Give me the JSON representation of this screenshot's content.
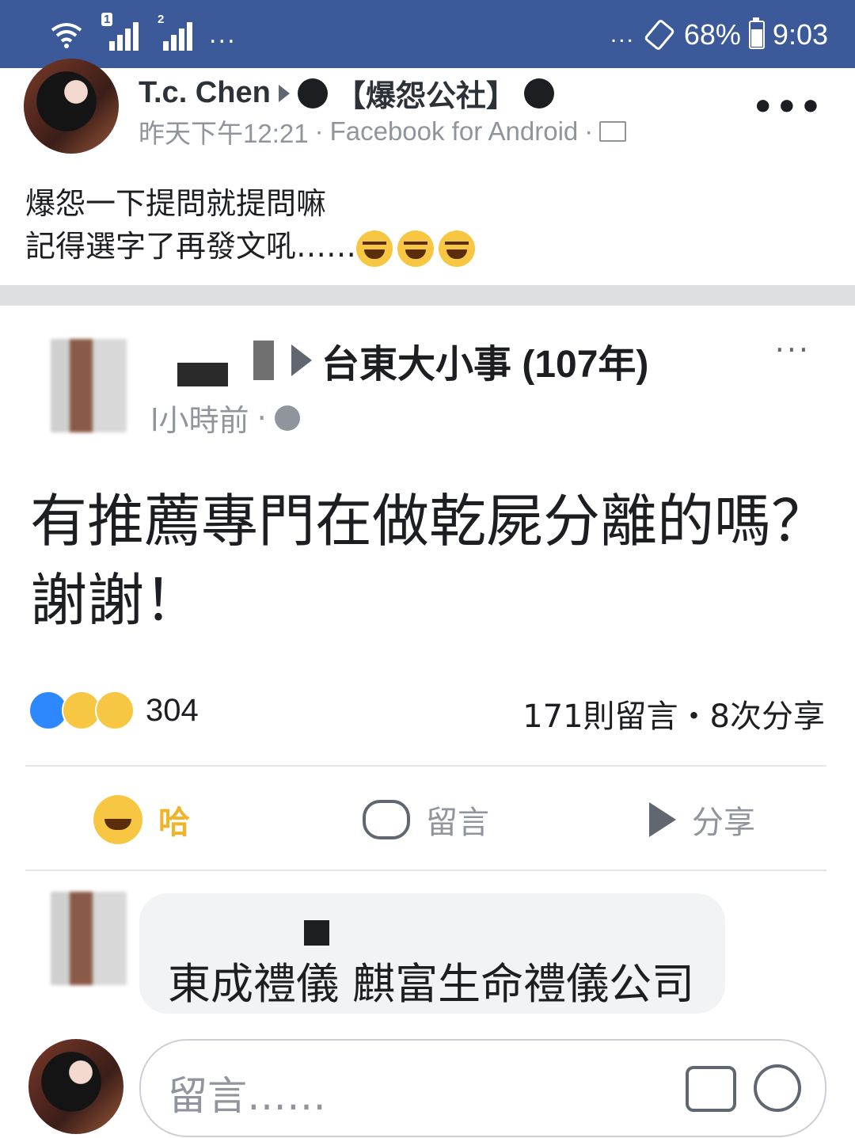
{
  "status_bar": {
    "sim1": "1",
    "sim2": "2",
    "left_dots": "...",
    "right_dots": "...",
    "battery": "68%",
    "time": "9:03",
    "icons": [
      "wifi-icon",
      "signal-sim1-icon",
      "signal-sim2-icon",
      "rotate-icon",
      "battery-icon"
    ]
  },
  "post": {
    "author": "T.c. Chen",
    "group": "【爆怨公社】",
    "timestamp": "昨天下午12:21",
    "via": "Facebook for Android",
    "sep": "·",
    "more": "•••",
    "text_line1": "爆怨一下提問就提問嘛",
    "text_line2": "記得選字了再發文吼……"
  },
  "shared": {
    "group": "台東大小事 (107年)",
    "time": "l小時前",
    "sep": "·",
    "more": "···",
    "text": "有推薦專門在做乾屍分離的嗎？謝謝！",
    "reaction_count": "304",
    "comments_shares": "171則留言・8次分享",
    "actions": {
      "haha": "哈",
      "comment": "留言",
      "share": "分享"
    },
    "comment_text": "東成禮儀 麒富生命禮儀公司",
    "input_placeholder": "留言……"
  }
}
